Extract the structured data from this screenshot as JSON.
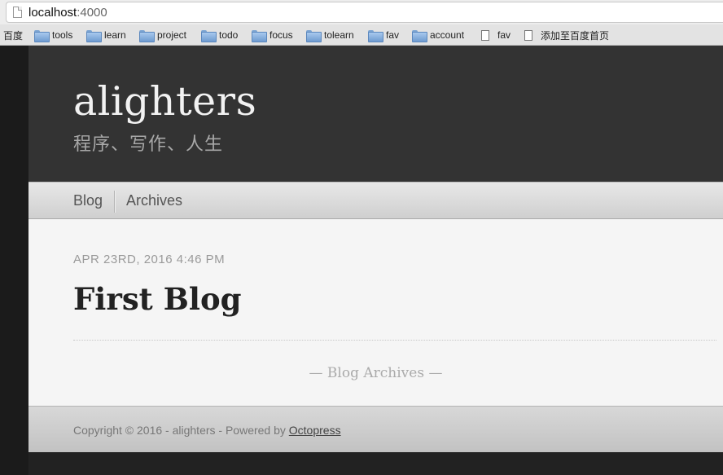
{
  "browser": {
    "url_host": "localhost",
    "url_port": ":4000"
  },
  "bookmarks": [
    {
      "label": "百度",
      "icon": "none"
    },
    {
      "label": "tools",
      "icon": "folder-icon"
    },
    {
      "label": "learn",
      "icon": "folder-icon"
    },
    {
      "label": "project",
      "icon": "folder-icon"
    },
    {
      "label": "todo",
      "icon": "folder-icon"
    },
    {
      "label": "focus",
      "icon": "folder-icon"
    },
    {
      "label": "tolearn",
      "icon": "folder-icon"
    },
    {
      "label": "fav",
      "icon": "folder-icon"
    },
    {
      "label": "account",
      "icon": "folder-icon"
    },
    {
      "label": "fav",
      "icon": "file-icon"
    },
    {
      "label": "添加至百度首页",
      "icon": "file-icon"
    }
  ],
  "site": {
    "title": "alighters",
    "subtitle": "程序、写作、人生"
  },
  "nav": {
    "items": [
      "Blog",
      "Archives"
    ]
  },
  "post": {
    "date": "APR 23RD, 2016 4:46 PM",
    "title": "First Blog"
  },
  "archives_link": "— Blog Archives —",
  "footer": {
    "text": "Copyright © 2016 - alighters - Powered by ",
    "link": "Octopress"
  },
  "colors": {
    "header_bg": "#333333",
    "content_bg": "#f5f5f5",
    "sidebar_bg": "#1b1b1b"
  }
}
